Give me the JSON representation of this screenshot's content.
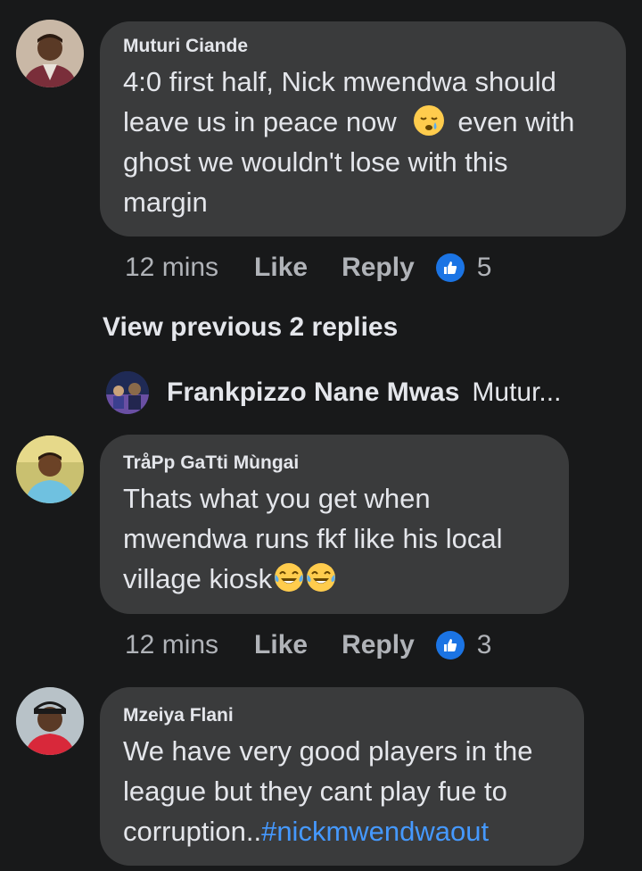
{
  "comments": [
    {
      "author": "Muturi Ciande",
      "text_lines": [
        "4:0 first half, Nick mwendwa should",
        "leave us in peace now",
        "even with",
        "ghost we wouldn't lose with this",
        "margin"
      ],
      "emoji": "sleepy-face",
      "time": "12 mins",
      "like_label": "Like",
      "reply_label": "Reply",
      "reaction_count": "5"
    },
    {
      "author": "TråPp GaTti Mùngai",
      "text_lines": [
        "Thats what you get when",
        "mwendwa runs fkf like his local",
        "village kiosk"
      ],
      "emoji": "face-with-tears-of-joy",
      "time": "12 mins",
      "like_label": "Like",
      "reply_label": "Reply",
      "reaction_count": "3"
    },
    {
      "author": "Mzeiya Flani",
      "text_lines": [
        "We have very good players in the",
        "league but they cant play fue to",
        "corruption.."
      ],
      "hashtag": "#nickmwendwaout"
    }
  ],
  "view_previous": "View previous 2 replies",
  "reply_preview": {
    "name": "Frankpizzo Nane Mwas",
    "snippet": "Mutur..."
  },
  "colors": {
    "background": "#18191a",
    "bubble": "#3a3b3c",
    "text": "#e4e6eb",
    "secondary_text": "#b0b3b8",
    "link": "#4599ff",
    "like_badge": "#1b74e4"
  }
}
